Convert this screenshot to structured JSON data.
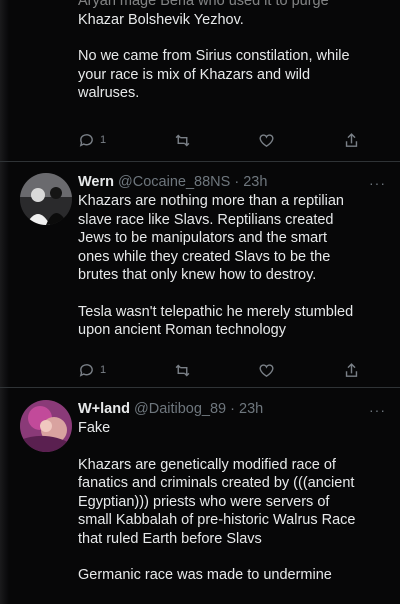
{
  "tweet0": {
    "line1": "Aryan mage Beria who used it to purge",
    "line2": "Khazar Bolshevik Yezhov.",
    "para2": [
      "No we came from Sirius constilation, while",
      "your race is mix of Khazars and wild",
      "walruses."
    ],
    "reply_count": "1"
  },
  "tweet1": {
    "name": "Wern",
    "handle": "@Cocaine_88NS",
    "time": "23h",
    "para1": [
      "Khazars are nothing more than a reptilian",
      "slave race like Slavs. Reptilians created",
      "Jews to be manipulators and the smart",
      "ones while they created Slavs to be the",
      "brutes that only knew how to destroy."
    ],
    "para2": [
      "Tesla wasn't telepathic he merely stumbled",
      "upon ancient Roman technology"
    ],
    "reply_count": "1"
  },
  "tweet2": {
    "name": "W+land",
    "handle": "@Daitibog_89",
    "time": "23h",
    "para0": "Fake",
    "para1": [
      "Khazars are genetically modified race of",
      "fanatics and criminals created by (((ancient",
      "Egyptian))) priests who were servers of",
      "small Kabbalah of pre-historic Walrus Race",
      "that ruled Earth before Slavs"
    ],
    "para2": "Germanic race was made to undermine"
  },
  "icons": [
    "reply-icon",
    "retweet-icon",
    "like-icon",
    "share-icon",
    "more-icon"
  ],
  "colors": {
    "background": "#070708",
    "text": "#e7e9ea",
    "muted": "#6e767d",
    "divider": "#2f3336"
  }
}
